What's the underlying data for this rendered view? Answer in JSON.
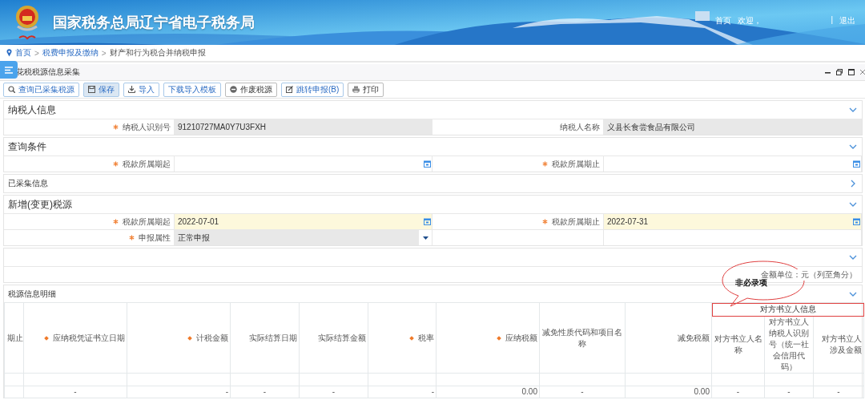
{
  "header": {
    "title": "国家税务总局辽宁省电子税务局",
    "home": "首页",
    "welcome": "欢迎，",
    "separator": "|",
    "logout": "退出"
  },
  "breadcrumb": [
    {
      "label": "首页",
      "kind": "home"
    },
    {
      "label": ">",
      "kind": "sep"
    },
    {
      "label": "税费申报及缴纳",
      "kind": "link"
    },
    {
      "label": ">",
      "kind": "sep"
    },
    {
      "label": "财产和行为税合并纳税申报",
      "kind": "current"
    }
  ],
  "panel": {
    "title": "花税税源信息采集"
  },
  "toolbar": [
    {
      "label": "查询已采集税源",
      "kind": "search",
      "selected": false
    },
    {
      "label": "保存",
      "kind": "save",
      "selected": true
    },
    {
      "label": "导入",
      "kind": "import",
      "selected": false
    },
    {
      "label": "下载导入模板",
      "kind": "template",
      "selected": false
    },
    {
      "label": "作废税源",
      "kind": "void",
      "selected": false
    },
    {
      "label": "跳转申报(B)",
      "kind": "jump",
      "selected": false
    },
    {
      "label": "打印",
      "kind": "print",
      "selected": false
    }
  ],
  "sections": [
    {
      "title": "纳税人信息",
      "expanded": true,
      "rows": [
        [
          {
            "label": "纳税人识别号",
            "required": true,
            "kind": "readonly",
            "value": "91210727MA0Y7U3FXH"
          },
          {
            "label": "纳税人名称",
            "required": false,
            "kind": "readonly",
            "value": "义县长食尝食品有限公司"
          }
        ]
      ]
    },
    {
      "title": "查询条件",
      "expanded": true,
      "rows": [
        [
          {
            "label": "税款所属期起",
            "required": true,
            "kind": "date",
            "highlight": false
          },
          {
            "label": "税款所属期止",
            "required": true,
            "kind": "date",
            "highlight": false
          }
        ]
      ]
    },
    {
      "title": "已采集信息",
      "expanded": false
    },
    {
      "title": "新增(变更)税源",
      "expanded": true,
      "rows": [
        [
          {
            "label": "税款所属期起",
            "required": true,
            "kind": "date",
            "highlight": true,
            "value": "2022-07-01"
          },
          {
            "label": "税款所属期止",
            "required": true,
            "kind": "date",
            "highlight": true,
            "value": "2022-07-31"
          }
        ],
        [
          {
            "label": "申报属性",
            "required": true,
            "kind": "select",
            "value": "正常申报"
          }
        ]
      ]
    },
    {
      "expanded": true,
      "note": "金额单位：元（列至角分）",
      "callout": "非必录项"
    }
  ],
  "detail": {
    "title": "税源信息明细",
    "expanded": true,
    "group": "对方书立人信息",
    "columns": [
      {
        "label": "期止",
        "required": false
      },
      {
        "label": "应纳税凭证书立日期",
        "required": true
      },
      {
        "label": "计税金额",
        "required": true
      },
      {
        "label": "实际结算日期",
        "required": false
      },
      {
        "label": "实际结算金额",
        "required": false
      },
      {
        "label": "税率",
        "required": true
      },
      {
        "label": "应纳税额",
        "required": true
      },
      {
        "label": "减免性质代码和项目名称",
        "required": false
      },
      {
        "label": "减免税额",
        "required": false
      },
      {
        "label": "对方书立人名称",
        "required": false
      },
      {
        "label": "对方书立人纳税人识别号（统一社会信用代码）",
        "required": false
      },
      {
        "label": "对方书立人涉及金额",
        "required": false
      }
    ],
    "rows": [
      [
        "",
        "-",
        "-",
        "-",
        "-",
        "-",
        "0.00",
        "-",
        "0.00",
        "-",
        "-",
        "-"
      ]
    ]
  }
}
